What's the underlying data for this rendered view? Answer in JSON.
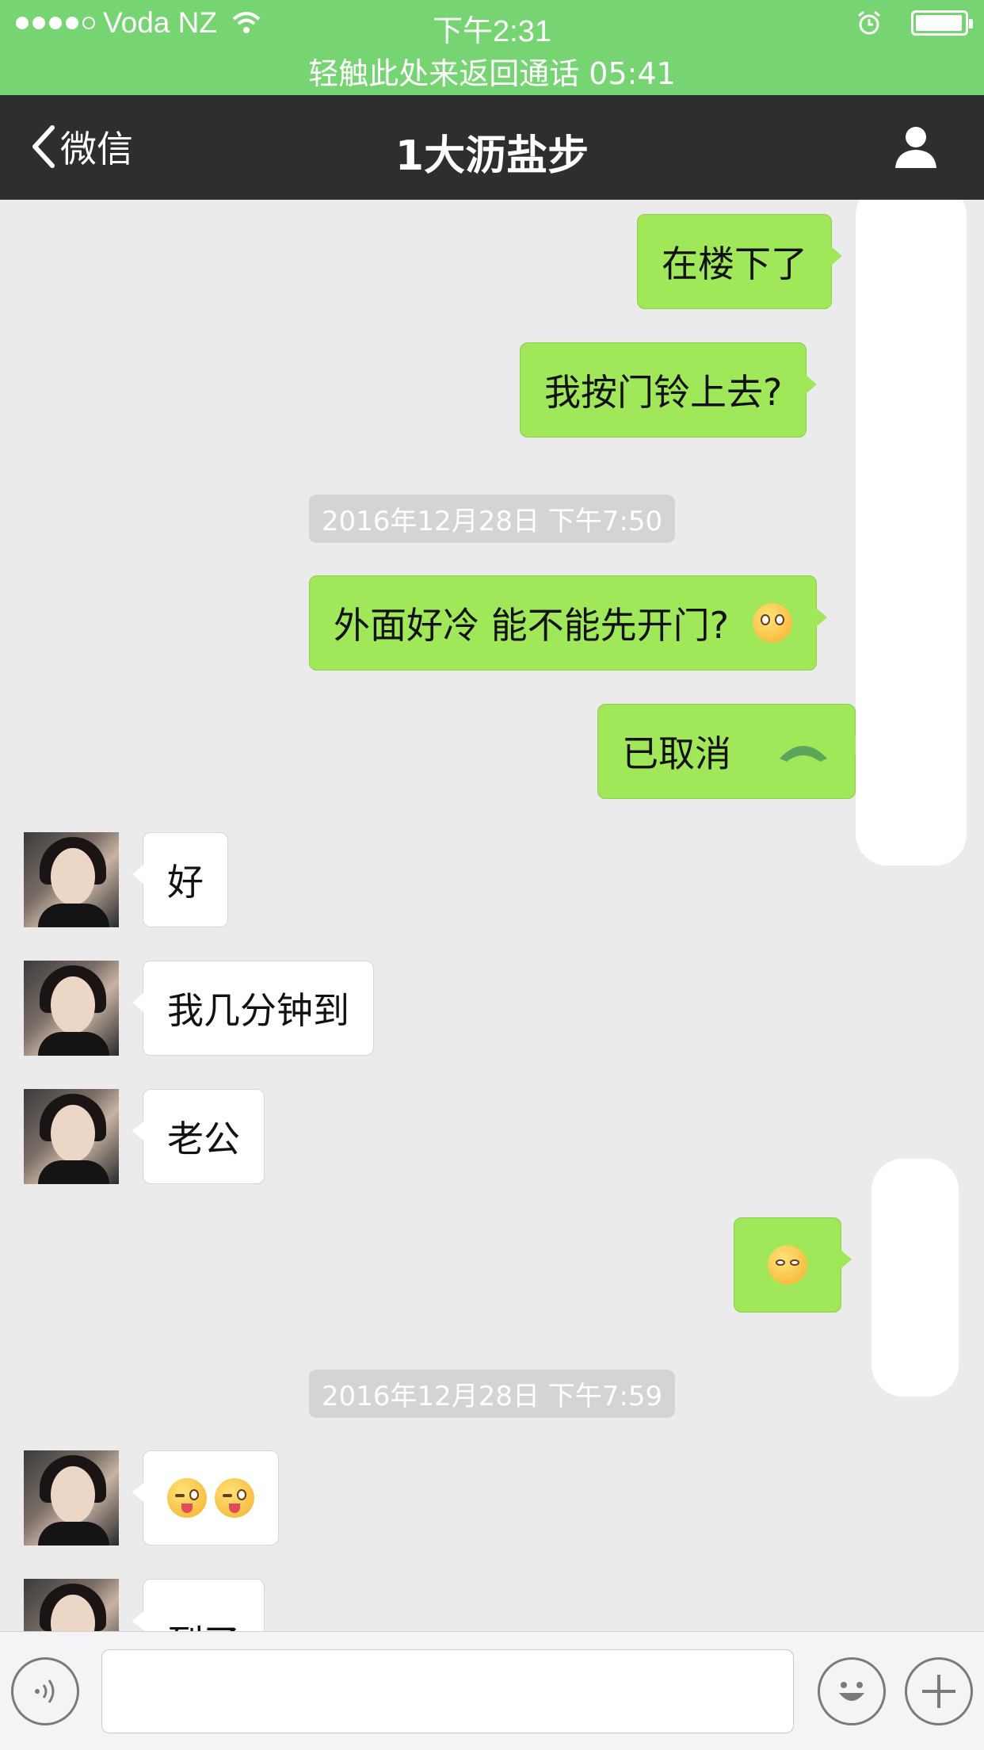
{
  "status_bar": {
    "carrier": "Voda NZ",
    "time": "下午2:31",
    "call_banner": "轻触此处来返回通话 05:41"
  },
  "nav": {
    "back_label": "微信",
    "title": "1大沥盐步"
  },
  "messages": [
    {
      "side": "out",
      "text": "在楼下了"
    },
    {
      "side": "out",
      "text": "我按门铃上去?"
    },
    {
      "type": "time",
      "text": "2016年12月28日 下午7:50"
    },
    {
      "side": "out",
      "text": "外面好冷 能不能先开门?",
      "emoji": "flushed-face-emoji"
    },
    {
      "side": "out",
      "text": "已取消",
      "icon": "phone-hangup-icon"
    },
    {
      "side": "in",
      "text": "好"
    },
    {
      "side": "in",
      "text": "我几分钟到"
    },
    {
      "side": "in",
      "text": "老公"
    },
    {
      "side": "out",
      "emoji": "smiling-face-emoji"
    },
    {
      "type": "time",
      "text": "2016年12月28日 下午7:59"
    },
    {
      "side": "in",
      "emoji": "winking-tongue-emoji ×2"
    },
    {
      "side": "in",
      "text": "到了"
    }
  ],
  "colors": {
    "status_green": "#76d572",
    "nav_dark": "#2e2e30",
    "bubble_out": "#a0e75a",
    "chat_bg": "#ebebeb"
  }
}
